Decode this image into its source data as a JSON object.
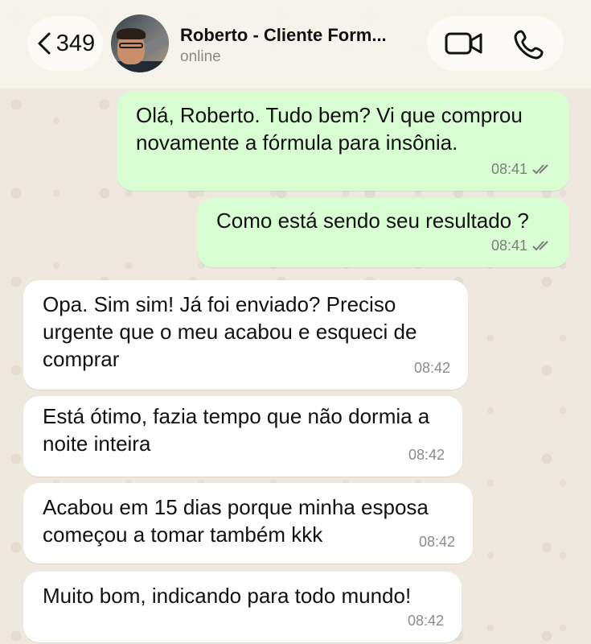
{
  "header": {
    "back_count": "349",
    "contact_name": "Roberto - Cliente Form...",
    "status": "online"
  },
  "messages": [
    {
      "direction": "outgoing",
      "text": "Olá, Roberto. Tudo bem? Vi que comprou novamente a fórmula para insônia.",
      "time": "08:41",
      "read": true
    },
    {
      "direction": "outgoing",
      "text": "Como está sendo seu resultado ?",
      "time": "08:41",
      "read": true
    },
    {
      "direction": "incoming",
      "text": "Opa. Sim sim! Já foi enviado? Preciso urgente que o meu acabou e esqueci de comprar",
      "time": "08:42"
    },
    {
      "direction": "incoming",
      "text": "Está ótimo, fazia tempo que não dormia a noite inteira",
      "time": "08:42"
    },
    {
      "direction": "incoming",
      "text": "Acabou em 15 dias porque minha esposa começou a tomar também kkk",
      "time": "08:42"
    },
    {
      "direction": "incoming",
      "text": "Muito bom, indicando para todo mundo!",
      "time": "08:42"
    }
  ],
  "icons": {
    "back": "chevron-left-icon",
    "video": "video-camera-icon",
    "call": "phone-icon",
    "read_receipt": "double-check-icon"
  },
  "colors": {
    "outgoing_bubble": "#d9fdd3",
    "incoming_bubble": "#ffffff",
    "read_ticks": "#7b7f7b"
  }
}
